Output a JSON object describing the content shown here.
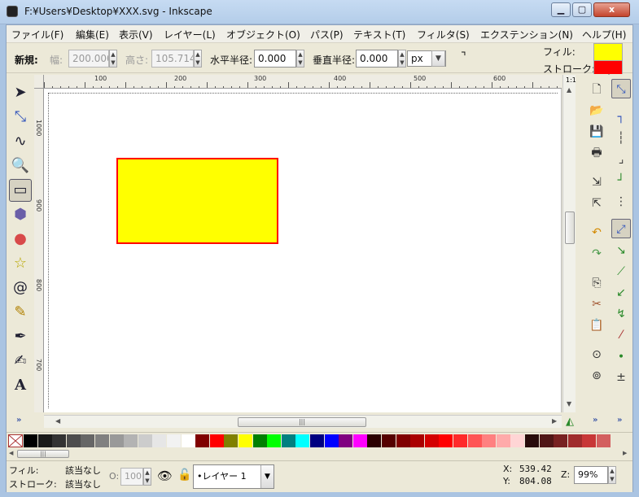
{
  "window": {
    "title": "F:¥Users¥Desktop¥XXX.svg - Inkscape",
    "min_icon": "minimize-icon",
    "max_icon": "maximize-icon",
    "close_label": "x"
  },
  "menu": [
    "ファイル(F)",
    "編集(E)",
    "表示(V)",
    "レイヤー(L)",
    "オブジェクト(O)",
    "パス(P)",
    "テキスト(T)",
    "フィルタ(S)",
    "エクステンション(N)",
    "ヘルプ(H)"
  ],
  "toolctrl": {
    "mode_label": "新規:",
    "width_label": "幅:",
    "width_value": "200.000",
    "height_label": "高さ:",
    "height_value": "105.714",
    "rx_label": "水平半径:",
    "rx_value": "0.000",
    "ry_label": "垂直半径:",
    "ry_value": "0.000",
    "unit": "px",
    "fill_label": "フィル:",
    "stroke_label": "ストローク:",
    "fill_color": "#ffff00",
    "stroke_color": "#ff0000"
  },
  "tools": [
    "selector-arrow-icon",
    "node-editor-icon",
    "tweak-icon",
    "zoom-icon",
    "rectangle-icon",
    "box3d-icon",
    "ellipse-icon",
    "star-icon",
    "spiral-icon",
    "pencil-icon",
    "pen-bezier-icon",
    "calligraphy-icon",
    "text-icon"
  ],
  "ruler": {
    "h_ticks": [
      "100",
      "200",
      "300",
      "400",
      "500",
      "600"
    ],
    "v_ticks": [
      "1000",
      "900",
      "800",
      "700"
    ]
  },
  "canvas": {
    "rect_fill": "#ffff00",
    "rect_stroke": "#ff0000"
  },
  "palette": [
    "#000000",
    "#1a1a1a",
    "#333333",
    "#4d4d4d",
    "#666666",
    "#808080",
    "#999999",
    "#b3b3b3",
    "#cccccc",
    "#e6e6e6",
    "#f2f2f2",
    "#ffffff",
    "#800000",
    "#ff0000",
    "#808000",
    "#ffff00",
    "#008000",
    "#00ff00",
    "#008080",
    "#00ffff",
    "#000080",
    "#0000ff",
    "#800080",
    "#ff00ff",
    "#2b0000",
    "#550000",
    "#800000",
    "#aa0000",
    "#d40000",
    "#ff0000",
    "#ff2a2a",
    "#ff5555",
    "#ff8080",
    "#ffaaaa",
    "#ffd5d5",
    "#280b0b",
    "#501616",
    "#782121",
    "#a02c2c",
    "#c83737",
    "#d35f5f"
  ],
  "status": {
    "fill_label": "フィル:",
    "fill_value": "該当なし",
    "stroke_label": "ストローク:",
    "stroke_value": "該当なし",
    "opacity_label": "O:",
    "opacity_value": "100",
    "layer": "•レイヤー 1",
    "x_label": "X:",
    "x_value": "539.42",
    "y_label": "Y:",
    "y_value": "804.08",
    "zoom_label": "Z:",
    "zoom_value": "99%"
  }
}
